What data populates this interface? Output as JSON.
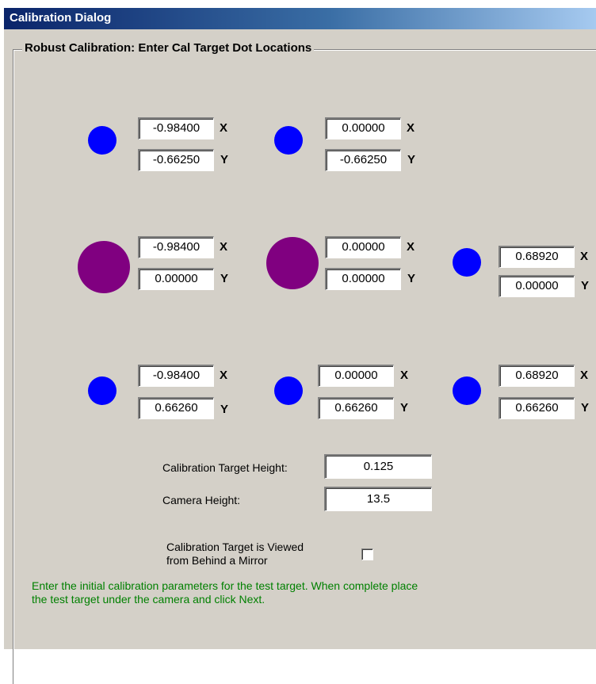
{
  "dialog": {
    "title": "Calibration Dialog",
    "group_title": "Robust Calibration: Enter Cal Target Dot Locations",
    "axis_x": "X",
    "axis_y": "Y",
    "colors": {
      "dot_normal": "#0000ff",
      "dot_highlight": "#800080",
      "instruction_text": "#008000"
    },
    "targets": [
      {
        "x": "-0.98400",
        "y": "-0.66250"
      },
      {
        "x": "0.00000",
        "y": "-0.66250"
      },
      {
        "x": "-0.98400",
        "y": "0.00000"
      },
      {
        "x": "0.00000",
        "y": "0.00000"
      },
      {
        "x": "0.68920",
        "y": "0.00000"
      },
      {
        "x": "-0.98400",
        "y": "0.66260"
      },
      {
        "x": "0.00000",
        "y": "0.66260"
      },
      {
        "x": "0.68920",
        "y": "0.66260"
      }
    ],
    "target_height_label": "Calibration Target Height:",
    "target_height_value": "0.125",
    "camera_height_label": "Camera Height:",
    "camera_height_value": "13.5",
    "mirror_label_line1": "Calibration Target is Viewed",
    "mirror_label_line2": "from Behind a Mirror",
    "mirror_checked": false,
    "instruction_line1": "Enter the initial calibration parameters for the test target.  When complete place",
    "instruction_line2": "the test target under the camera and click Next."
  }
}
